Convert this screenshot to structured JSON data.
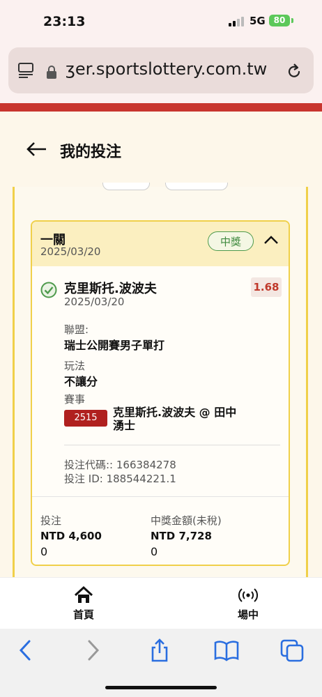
{
  "status": {
    "time": "23:13",
    "network": "5G",
    "battery": "80"
  },
  "browser": {
    "url": "ʒer.sportslottery.com.tw"
  },
  "header": {
    "title": "我的投注"
  },
  "bet": {
    "type": "一關",
    "date": "2025/03/20",
    "status_badge": "中獎",
    "selection": {
      "name": "克里斯托.波波夫",
      "date": "2025/03/20",
      "odds": "1.68",
      "league_label": "聯盟:",
      "league_value": "瑞士公開賽男子單打",
      "market_label": "玩法",
      "market_value": "不讓分",
      "event_label": "賽事",
      "event_code": "2515",
      "event_name": "克里斯托.波波夫 @ 田中湧士"
    },
    "bet_code": "投注代碼:: 166384278",
    "bet_id": "投注 ID: 188544221.1",
    "stake_label": "投注",
    "stake_value": "NTD 4,600",
    "stake_sub": "0",
    "payout_label": "中獎金額(未稅)",
    "payout_value": "NTD 7,728",
    "payout_sub": "0"
  },
  "nav": {
    "home": "首頁",
    "live": "場中"
  },
  "colors": {
    "accent_red": "#c8352e",
    "win_green": "#4e9a4c",
    "card_border": "#f0d04a"
  }
}
